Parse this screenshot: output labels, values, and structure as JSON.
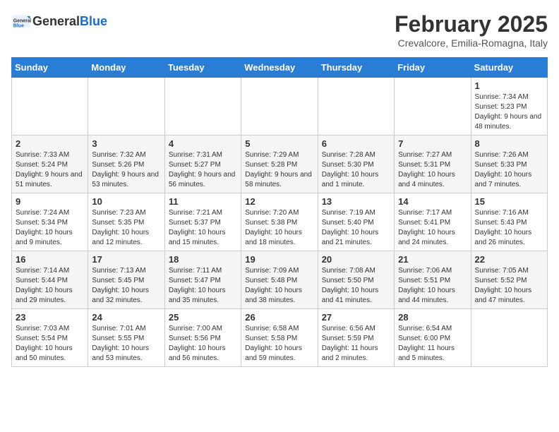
{
  "header": {
    "logo_general": "General",
    "logo_blue": "Blue",
    "month_title": "February 2025",
    "location": "Crevalcore, Emilia-Romagna, Italy"
  },
  "days_of_week": [
    "Sunday",
    "Monday",
    "Tuesday",
    "Wednesday",
    "Thursday",
    "Friday",
    "Saturday"
  ],
  "weeks": [
    [
      {
        "day": "",
        "info": ""
      },
      {
        "day": "",
        "info": ""
      },
      {
        "day": "",
        "info": ""
      },
      {
        "day": "",
        "info": ""
      },
      {
        "day": "",
        "info": ""
      },
      {
        "day": "",
        "info": ""
      },
      {
        "day": "1",
        "info": "Sunrise: 7:34 AM\nSunset: 5:23 PM\nDaylight: 9 hours and 48 minutes."
      }
    ],
    [
      {
        "day": "2",
        "info": "Sunrise: 7:33 AM\nSunset: 5:24 PM\nDaylight: 9 hours and 51 minutes."
      },
      {
        "day": "3",
        "info": "Sunrise: 7:32 AM\nSunset: 5:26 PM\nDaylight: 9 hours and 53 minutes."
      },
      {
        "day": "4",
        "info": "Sunrise: 7:31 AM\nSunset: 5:27 PM\nDaylight: 9 hours and 56 minutes."
      },
      {
        "day": "5",
        "info": "Sunrise: 7:29 AM\nSunset: 5:28 PM\nDaylight: 9 hours and 58 minutes."
      },
      {
        "day": "6",
        "info": "Sunrise: 7:28 AM\nSunset: 5:30 PM\nDaylight: 10 hours and 1 minute."
      },
      {
        "day": "7",
        "info": "Sunrise: 7:27 AM\nSunset: 5:31 PM\nDaylight: 10 hours and 4 minutes."
      },
      {
        "day": "8",
        "info": "Sunrise: 7:26 AM\nSunset: 5:33 PM\nDaylight: 10 hours and 7 minutes."
      }
    ],
    [
      {
        "day": "9",
        "info": "Sunrise: 7:24 AM\nSunset: 5:34 PM\nDaylight: 10 hours and 9 minutes."
      },
      {
        "day": "10",
        "info": "Sunrise: 7:23 AM\nSunset: 5:35 PM\nDaylight: 10 hours and 12 minutes."
      },
      {
        "day": "11",
        "info": "Sunrise: 7:21 AM\nSunset: 5:37 PM\nDaylight: 10 hours and 15 minutes."
      },
      {
        "day": "12",
        "info": "Sunrise: 7:20 AM\nSunset: 5:38 PM\nDaylight: 10 hours and 18 minutes."
      },
      {
        "day": "13",
        "info": "Sunrise: 7:19 AM\nSunset: 5:40 PM\nDaylight: 10 hours and 21 minutes."
      },
      {
        "day": "14",
        "info": "Sunrise: 7:17 AM\nSunset: 5:41 PM\nDaylight: 10 hours and 24 minutes."
      },
      {
        "day": "15",
        "info": "Sunrise: 7:16 AM\nSunset: 5:43 PM\nDaylight: 10 hours and 26 minutes."
      }
    ],
    [
      {
        "day": "16",
        "info": "Sunrise: 7:14 AM\nSunset: 5:44 PM\nDaylight: 10 hours and 29 minutes."
      },
      {
        "day": "17",
        "info": "Sunrise: 7:13 AM\nSunset: 5:45 PM\nDaylight: 10 hours and 32 minutes."
      },
      {
        "day": "18",
        "info": "Sunrise: 7:11 AM\nSunset: 5:47 PM\nDaylight: 10 hours and 35 minutes."
      },
      {
        "day": "19",
        "info": "Sunrise: 7:09 AM\nSunset: 5:48 PM\nDaylight: 10 hours and 38 minutes."
      },
      {
        "day": "20",
        "info": "Sunrise: 7:08 AM\nSunset: 5:50 PM\nDaylight: 10 hours and 41 minutes."
      },
      {
        "day": "21",
        "info": "Sunrise: 7:06 AM\nSunset: 5:51 PM\nDaylight: 10 hours and 44 minutes."
      },
      {
        "day": "22",
        "info": "Sunrise: 7:05 AM\nSunset: 5:52 PM\nDaylight: 10 hours and 47 minutes."
      }
    ],
    [
      {
        "day": "23",
        "info": "Sunrise: 7:03 AM\nSunset: 5:54 PM\nDaylight: 10 hours and 50 minutes."
      },
      {
        "day": "24",
        "info": "Sunrise: 7:01 AM\nSunset: 5:55 PM\nDaylight: 10 hours and 53 minutes."
      },
      {
        "day": "25",
        "info": "Sunrise: 7:00 AM\nSunset: 5:56 PM\nDaylight: 10 hours and 56 minutes."
      },
      {
        "day": "26",
        "info": "Sunrise: 6:58 AM\nSunset: 5:58 PM\nDaylight: 10 hours and 59 minutes."
      },
      {
        "day": "27",
        "info": "Sunrise: 6:56 AM\nSunset: 5:59 PM\nDaylight: 11 hours and 2 minutes."
      },
      {
        "day": "28",
        "info": "Sunrise: 6:54 AM\nSunset: 6:00 PM\nDaylight: 11 hours and 5 minutes."
      },
      {
        "day": "",
        "info": ""
      }
    ]
  ]
}
